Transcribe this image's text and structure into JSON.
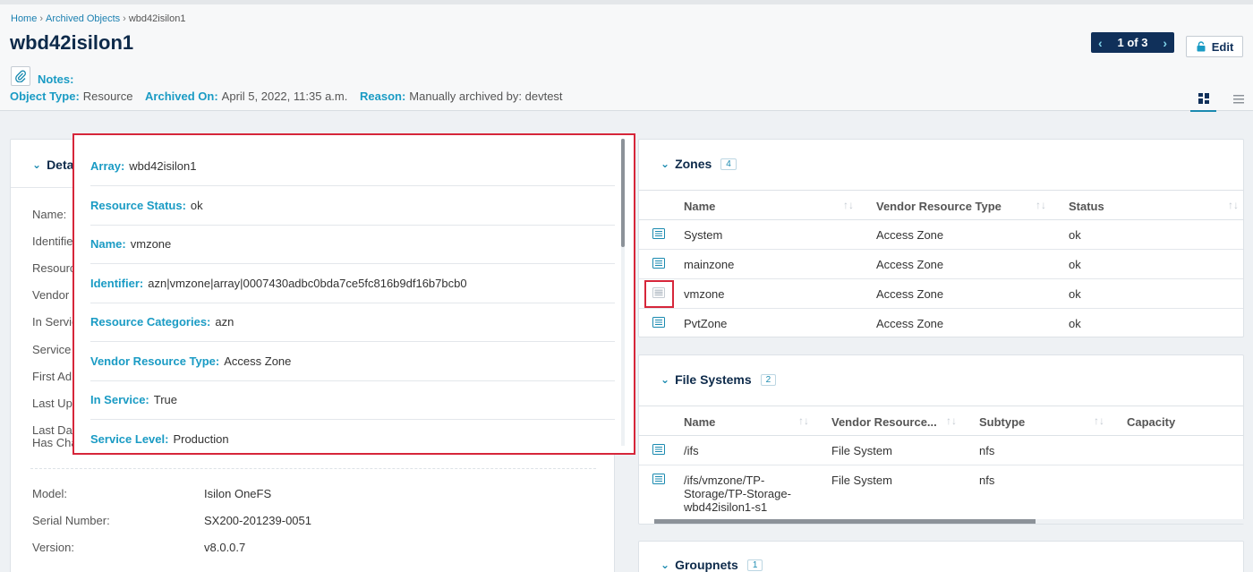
{
  "breadcrumb": [
    "Home",
    "Archived Objects",
    "wbd42isilon1"
  ],
  "breadcrumb_sep": "›",
  "title": "wbd42isilon1",
  "pager": {
    "label": "1 of 3"
  },
  "edit_label": "Edit",
  "notes_label": "Notes:",
  "meta": [
    {
      "key": "Object Type:",
      "value": "Resource"
    },
    {
      "key": "Archived On:",
      "value": "April 5, 2022, 11:35 a.m."
    },
    {
      "key": "Reason:",
      "value": "Manually archived by: devtest"
    }
  ],
  "details": {
    "title": "Deta",
    "left_labels": [
      "Name:",
      "Identifie",
      "Resourc",
      "Vendor",
      "In Servic",
      "Service",
      "First Ad",
      "Last Upc",
      "Last Dat",
      "Has Cha"
    ],
    "rows": [
      {
        "label": "Model:",
        "value": "Isilon OneFS"
      },
      {
        "label": "Serial Number:",
        "value": "SX200-201239-0051"
      },
      {
        "label": "Version:",
        "value": "v8.0.0.7"
      }
    ]
  },
  "popup": {
    "items": [
      {
        "key": "Array:",
        "value": "wbd42isilon1"
      },
      {
        "key": "Resource Status:",
        "value": "ok"
      },
      {
        "key": "Name:",
        "value": "vmzone"
      },
      {
        "key": "Identifier:",
        "value": "azn|vmzone|array|0007430adbc0bda7ce5fc816b9df16b7bcb0"
      },
      {
        "key": "Resource Categories:",
        "value": "azn"
      },
      {
        "key": "Vendor Resource Type:",
        "value": "Access Zone"
      },
      {
        "key": "In Service:",
        "value": "True"
      },
      {
        "key": "Service Level:",
        "value": "Production"
      }
    ]
  },
  "zones": {
    "title": "Zones",
    "count": "4",
    "columns": [
      "Name",
      "Vendor Resource Type",
      "Status"
    ],
    "rows": [
      [
        "System",
        "Access Zone",
        "ok"
      ],
      [
        "mainzone",
        "Access Zone",
        "ok"
      ],
      [
        "vmzone",
        "Access Zone",
        "ok"
      ],
      [
        "PvtZone",
        "Access Zone",
        "ok"
      ]
    ]
  },
  "file_systems": {
    "title": "File Systems",
    "count": "2",
    "columns": [
      "Name",
      "Vendor Resource...",
      "Subtype",
      "Capacity"
    ],
    "rows": [
      [
        "/ifs",
        "File System",
        "nfs"
      ],
      [
        "/ifs/vmzone/TP-Storage/TP-Storage-wbd42isilon1-s1",
        "File System",
        "nfs"
      ]
    ],
    "row2_lines": [
      "/ifs/vmzone/TP-",
      "Storage/TP-Storage-",
      "wbd42isilon1-s1"
    ]
  },
  "groupnets": {
    "title": "Groupnets",
    "count": "1"
  },
  "colors": {
    "accent": "#1a9bc4",
    "navy": "#10305a",
    "highlight": "#d6263a"
  }
}
